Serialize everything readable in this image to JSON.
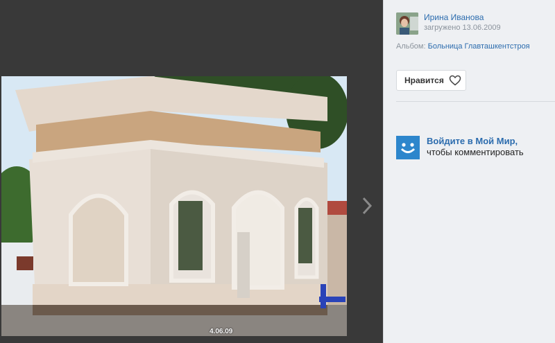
{
  "photo": {
    "date_stamp": "4.06.09",
    "next_label": "›"
  },
  "sidebar": {
    "author_name": "Ирина Иванова",
    "uploaded_label": "загружено",
    "uploaded_date": "13.06.2009",
    "album_prefix": "Альбом:",
    "album_name": "Больница Главташкентстроя",
    "like_label": "Нравится",
    "login_link": "Войдите в Мой Мир,",
    "login_text": "чтобы комментировать"
  },
  "icons": {
    "next": "chevron-right-icon",
    "like": "heart-icon",
    "logo": "moy-mir-smile-icon"
  },
  "colors": {
    "link": "#2c6cae",
    "panel_bg": "#eef0f3",
    "viewer_bg": "#393939",
    "logo_bg": "#2d86cc"
  }
}
